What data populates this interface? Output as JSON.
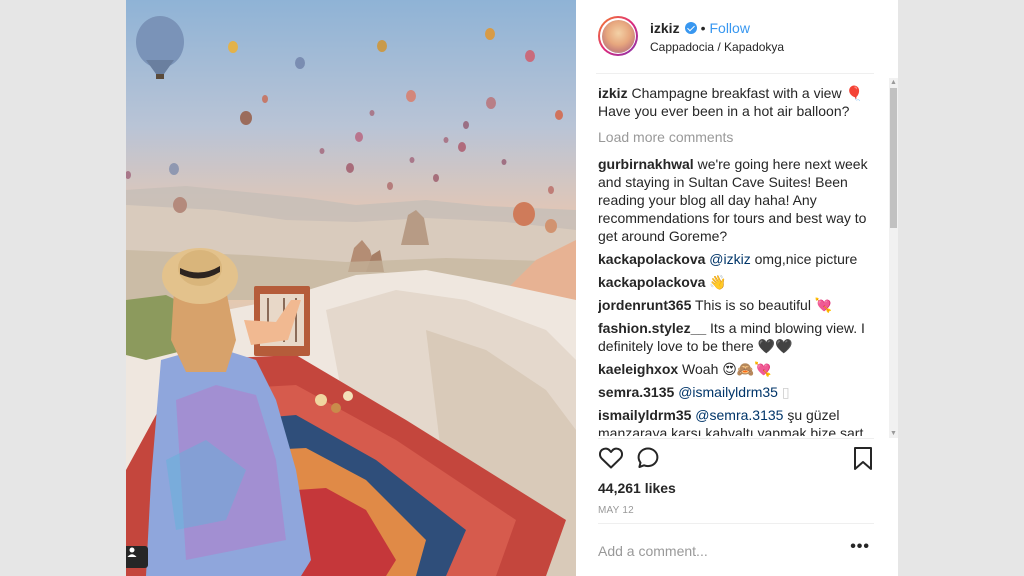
{
  "post": {
    "user": {
      "username": "izkiz",
      "follow_label": "Follow",
      "separator": "•",
      "location": "Cappadocia / Kapadokya",
      "verified": true
    },
    "caption": {
      "username": "izkiz",
      "text": "Champagne breakfast with a view 🎈 Have you ever been in a hot air balloon?"
    },
    "load_more_label": "Load more comments",
    "comments": [
      {
        "username": "gurbirnakhwal",
        "mention": "",
        "text": "we're going here next week and staying in Sultan Cave Suites! Been reading your blog all day haha! Any recommendations for tours and best way to get around Goreme?"
      },
      {
        "username": "kackapolackova",
        "mention": "@izkiz",
        "text": "omg,nice picture"
      },
      {
        "username": "kackapolackova",
        "mention": "",
        "text": "👋"
      },
      {
        "username": "jordenrunt365",
        "mention": "",
        "text": "This is so beautiful 💘"
      },
      {
        "username": "fashion.stylez__",
        "mention": "",
        "text": "Its a mind blowing view. I definitely love to be there 🖤🖤"
      },
      {
        "username": "kaeleighxox",
        "mention": "",
        "text": "Woah 😍🙈💘"
      },
      {
        "username": "semra.3135",
        "mention": "@ismailyldrm35",
        "text": "▯"
      },
      {
        "username": "ismailyldrm35",
        "mention": "@semra.3135",
        "text": "şu güzel manzaraya karşı kahvaltı yapmak bize şart ☺"
      }
    ],
    "likes": "44,261 likes",
    "date": "MAY 12",
    "add_comment_placeholder": "Add a comment...",
    "more_label": "•••",
    "icons": {
      "like": "heart-icon",
      "comment": "comment-bubble-icon",
      "save": "bookmark-icon",
      "more": "more-options-icon",
      "tag": "user-tag-icon",
      "verified": "verified-badge-icon"
    },
    "colors": {
      "link": "#3897f0",
      "mention": "#003569",
      "muted": "#999999",
      "text": "#262626"
    }
  }
}
